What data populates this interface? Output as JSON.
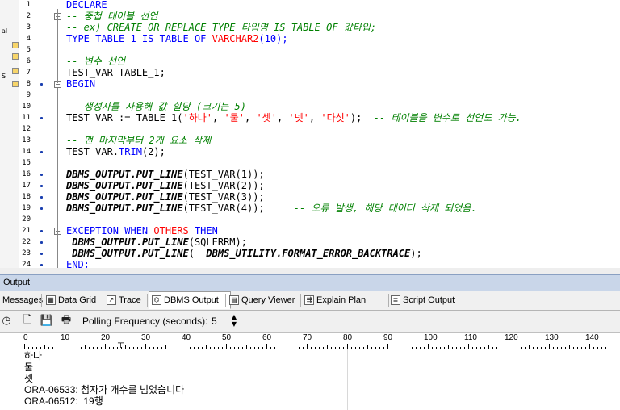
{
  "left_panel": {
    "fragments": [
      "al",
      "S"
    ]
  },
  "editor": {
    "line_numbers": [
      "1",
      "2",
      "3",
      "4",
      "5",
      "6",
      "7",
      "8",
      "9",
      "10",
      "11",
      "12",
      "13",
      "14",
      "15",
      "16",
      "17",
      "18",
      "19",
      "20",
      "21",
      "22",
      "23",
      "24"
    ],
    "lines": [
      {
        "n": 1,
        "segs": [
          {
            "t": "DECLARE",
            "c": "kw"
          }
        ]
      },
      {
        "n": 2,
        "segs": [
          {
            "t": "-- 중첩 테이블 선언",
            "c": "cm"
          }
        ]
      },
      {
        "n": 3,
        "segs": [
          {
            "t": "-- ex) CREATE OR REPLACE TYPE 타입명 IS TABLE OF 값타입;",
            "c": "cm"
          }
        ]
      },
      {
        "n": 4,
        "segs": [
          {
            "t": "TYPE TABLE_1 IS TABLE OF ",
            "c": "kw"
          },
          {
            "t": "VARCHAR2",
            "c": "red"
          },
          {
            "t": "(10);",
            "c": "kw"
          }
        ]
      },
      {
        "n": 5,
        "segs": []
      },
      {
        "n": 6,
        "segs": [
          {
            "t": "-- 변수 선언",
            "c": "cm"
          }
        ]
      },
      {
        "n": 7,
        "segs": [
          {
            "t": "TEST_VAR TABLE_1;",
            "c": ""
          }
        ]
      },
      {
        "n": 8,
        "segs": [
          {
            "t": "BEGIN",
            "c": "kw"
          }
        ]
      },
      {
        "n": 9,
        "segs": []
      },
      {
        "n": 10,
        "segs": [
          {
            "t": "-- 생성자를 사용해 값 할당 (크기는 5)",
            "c": "cm"
          }
        ]
      },
      {
        "n": 11,
        "segs": [
          {
            "t": "TEST_VAR := TABLE_1(",
            "c": ""
          },
          {
            "t": "'하나'",
            "c": "st"
          },
          {
            "t": ", ",
            "c": ""
          },
          {
            "t": "'둘'",
            "c": "st"
          },
          {
            "t": ", ",
            "c": ""
          },
          {
            "t": "'셋'",
            "c": "st"
          },
          {
            "t": ", ",
            "c": ""
          },
          {
            "t": "'넷'",
            "c": "st"
          },
          {
            "t": ", ",
            "c": ""
          },
          {
            "t": "'다섯'",
            "c": "st"
          },
          {
            "t": ");  ",
            "c": ""
          },
          {
            "t": "-- 테이블을 변수로 선언도 가능.",
            "c": "cm"
          }
        ]
      },
      {
        "n": 12,
        "segs": []
      },
      {
        "n": 13,
        "segs": [
          {
            "t": "-- 맨 마지막부터 2개 요소 삭제",
            "c": "cm"
          }
        ]
      },
      {
        "n": 14,
        "segs": [
          {
            "t": "TEST_VAR.",
            "c": ""
          },
          {
            "t": "TRIM",
            "c": "kw"
          },
          {
            "t": "(2);",
            "c": ""
          }
        ]
      },
      {
        "n": 15,
        "segs": []
      },
      {
        "n": 16,
        "segs": [
          {
            "t": "DBMS_OUTPUT.PUT_LINE",
            "c": "fn"
          },
          {
            "t": "(TEST_VAR(1));",
            "c": ""
          }
        ]
      },
      {
        "n": 17,
        "segs": [
          {
            "t": "DBMS_OUTPUT.PUT_LINE",
            "c": "fn"
          },
          {
            "t": "(TEST_VAR(2));",
            "c": ""
          }
        ]
      },
      {
        "n": 18,
        "segs": [
          {
            "t": "DBMS_OUTPUT.PUT_LINE",
            "c": "fn"
          },
          {
            "t": "(TEST_VAR(3));",
            "c": ""
          }
        ]
      },
      {
        "n": 19,
        "segs": [
          {
            "t": "DBMS_OUTPUT.PUT_LINE",
            "c": "fn"
          },
          {
            "t": "(TEST_VAR(4));     ",
            "c": ""
          },
          {
            "t": "-- 오류 발생, 해당 데이터 삭제 되었음.",
            "c": "cm"
          }
        ]
      },
      {
        "n": 20,
        "segs": []
      },
      {
        "n": 21,
        "segs": [
          {
            "t": "EXCEPTION WHEN ",
            "c": "kw"
          },
          {
            "t": "OTHERS",
            "c": "red"
          },
          {
            "t": " THEN",
            "c": "kw"
          }
        ]
      },
      {
        "n": 22,
        "segs": [
          {
            "t": " DBMS_OUTPUT.PUT_LINE",
            "c": "fn"
          },
          {
            "t": "(SQLERRM);",
            "c": ""
          }
        ]
      },
      {
        "n": 23,
        "segs": [
          {
            "t": " DBMS_OUTPUT.PUT_LINE",
            "c": "fn"
          },
          {
            "t": "( ",
            "c": ""
          },
          {
            "t": " DBMS_UTILITY.FORMAT_ERROR_BACKTRACE",
            "c": "fn"
          },
          {
            "t": ");",
            "c": ""
          }
        ]
      },
      {
        "n": 24,
        "segs": [
          {
            "t": "END;",
            "c": "kw"
          }
        ]
      }
    ],
    "dot_lines": [
      8,
      11,
      14,
      16,
      17,
      18,
      19,
      21,
      22,
      23,
      24
    ],
    "fold_lines": [
      2,
      8,
      21
    ]
  },
  "output_panel": {
    "title": "Output",
    "tabs": [
      {
        "label": "Messages",
        "icon": "message-icon"
      },
      {
        "label": "Data Grid",
        "icon": "grid-icon"
      },
      {
        "label": "Trace",
        "icon": "trace-icon"
      },
      {
        "label": "DBMS Output",
        "icon": "dbms-output-icon",
        "active": true
      },
      {
        "label": "Query Viewer",
        "icon": "query-viewer-icon"
      },
      {
        "label": "Explain Plan",
        "icon": "explain-plan-icon"
      },
      {
        "label": "Script Output",
        "icon": "script-output-icon"
      }
    ],
    "toolbar": {
      "icons": [
        "polling-toggle-icon",
        "new-icon",
        "save-icon",
        "print-icon"
      ],
      "polling_label": "Polling Frequency (seconds):",
      "polling_value": "5"
    },
    "ruler": [
      "0",
      "10",
      "20",
      "30",
      "40",
      "50",
      "60",
      "70",
      "80",
      "90",
      "100",
      "110",
      "120",
      "130",
      "140"
    ],
    "lines": [
      "하나",
      "둘",
      "셋",
      "ORA-06533: 첨자가 개수를 넘었습니다",
      "ORA-06512:  19행"
    ]
  }
}
